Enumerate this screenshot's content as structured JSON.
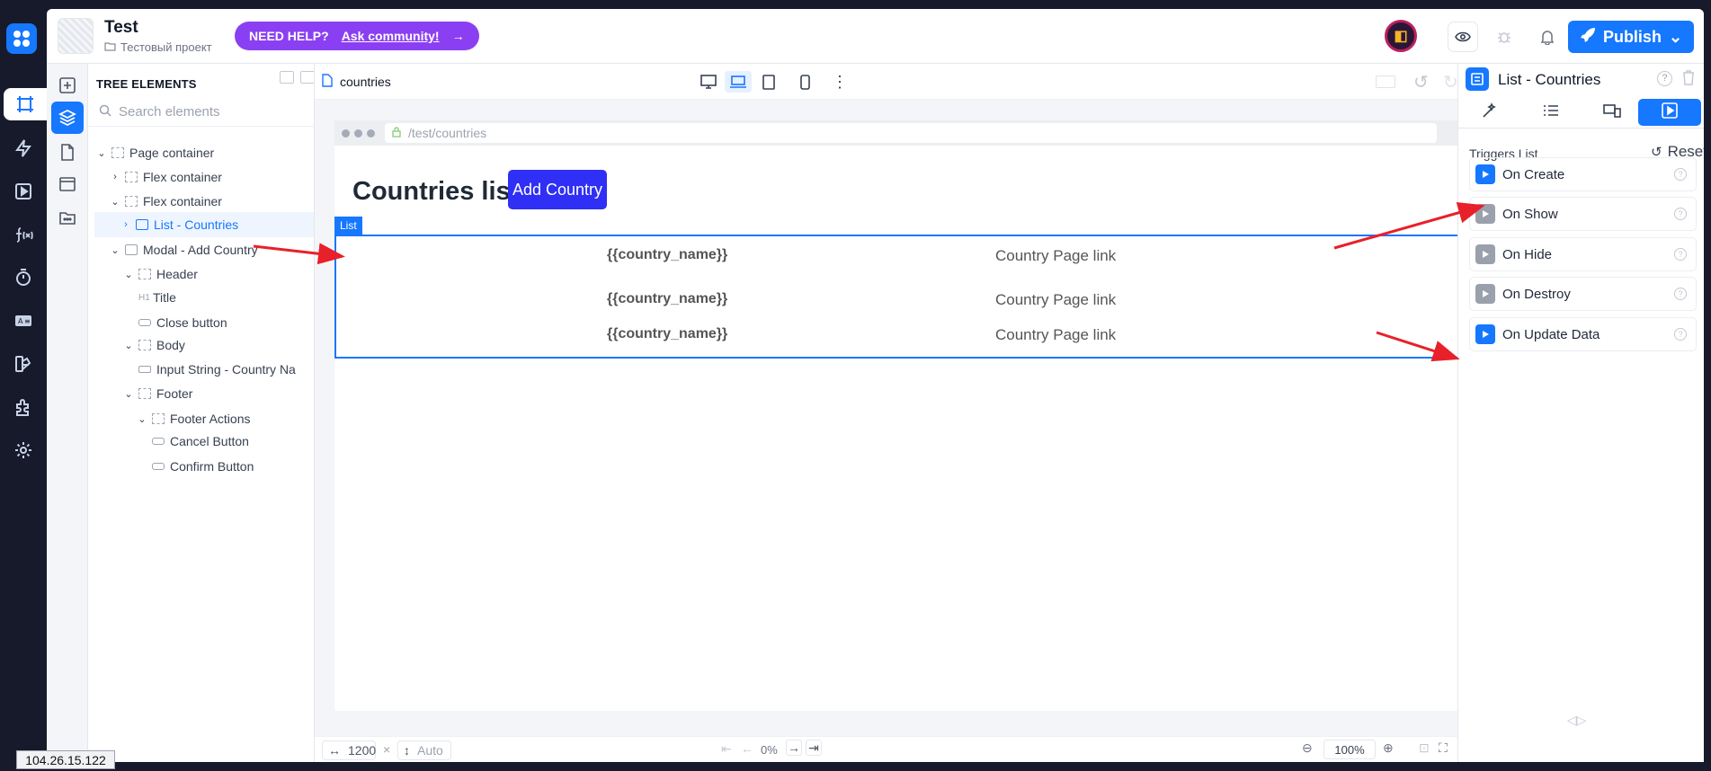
{
  "header": {
    "project_name": "Test",
    "project_sub": "Тестовый проект",
    "help_label": "NEED HELP?",
    "help_link": "Ask community!",
    "avatar_glyph": "◧",
    "publish_label": "Publish"
  },
  "tree": {
    "title": "TREE ELEMENTS",
    "search_placeholder": "Search elements",
    "items": [
      {
        "label": "Page container"
      },
      {
        "label": "Flex container"
      },
      {
        "label": "Flex container"
      },
      {
        "label": "List - Countries"
      },
      {
        "label": "Modal - Add Country"
      },
      {
        "label": "Header"
      },
      {
        "label": "Title"
      },
      {
        "label": "Close button"
      },
      {
        "label": "Body"
      },
      {
        "label": "Input String - Country Na"
      },
      {
        "label": "Footer"
      },
      {
        "label": "Footer Actions"
      },
      {
        "label": "Cancel Button"
      },
      {
        "label": "Confirm Button"
      }
    ]
  },
  "canvas": {
    "page_name": "countries",
    "url": "/test/countries",
    "heading": "Countries list",
    "add_button": "Add Country",
    "list_tag": "List",
    "rows": [
      {
        "name": "{{country_name}}",
        "link": "Country Page link"
      },
      {
        "name": "{{country_name}}",
        "link": "Country Page link"
      },
      {
        "name": "{{country_name}}",
        "link": "Country Page link"
      }
    ],
    "width_value": "1200",
    "times": "×",
    "height_value": "Auto",
    "progress": "0%",
    "zoom": "100%"
  },
  "panel": {
    "title": "List - Countries",
    "triggers_label": "Triggers List",
    "reset_label": "Reset",
    "triggers": [
      {
        "label": "On Create",
        "active": true
      },
      {
        "label": "On Show",
        "active": false
      },
      {
        "label": "On Hide",
        "active": false
      },
      {
        "label": "On Destroy",
        "active": false
      },
      {
        "label": "On Update Data",
        "active": true
      }
    ]
  },
  "ip": "104.26.15.122",
  "colors": {
    "accent": "#1677ff",
    "help": "#8b3ff2",
    "add_button": "#2f2ff5",
    "annotation": "#e8202a"
  }
}
